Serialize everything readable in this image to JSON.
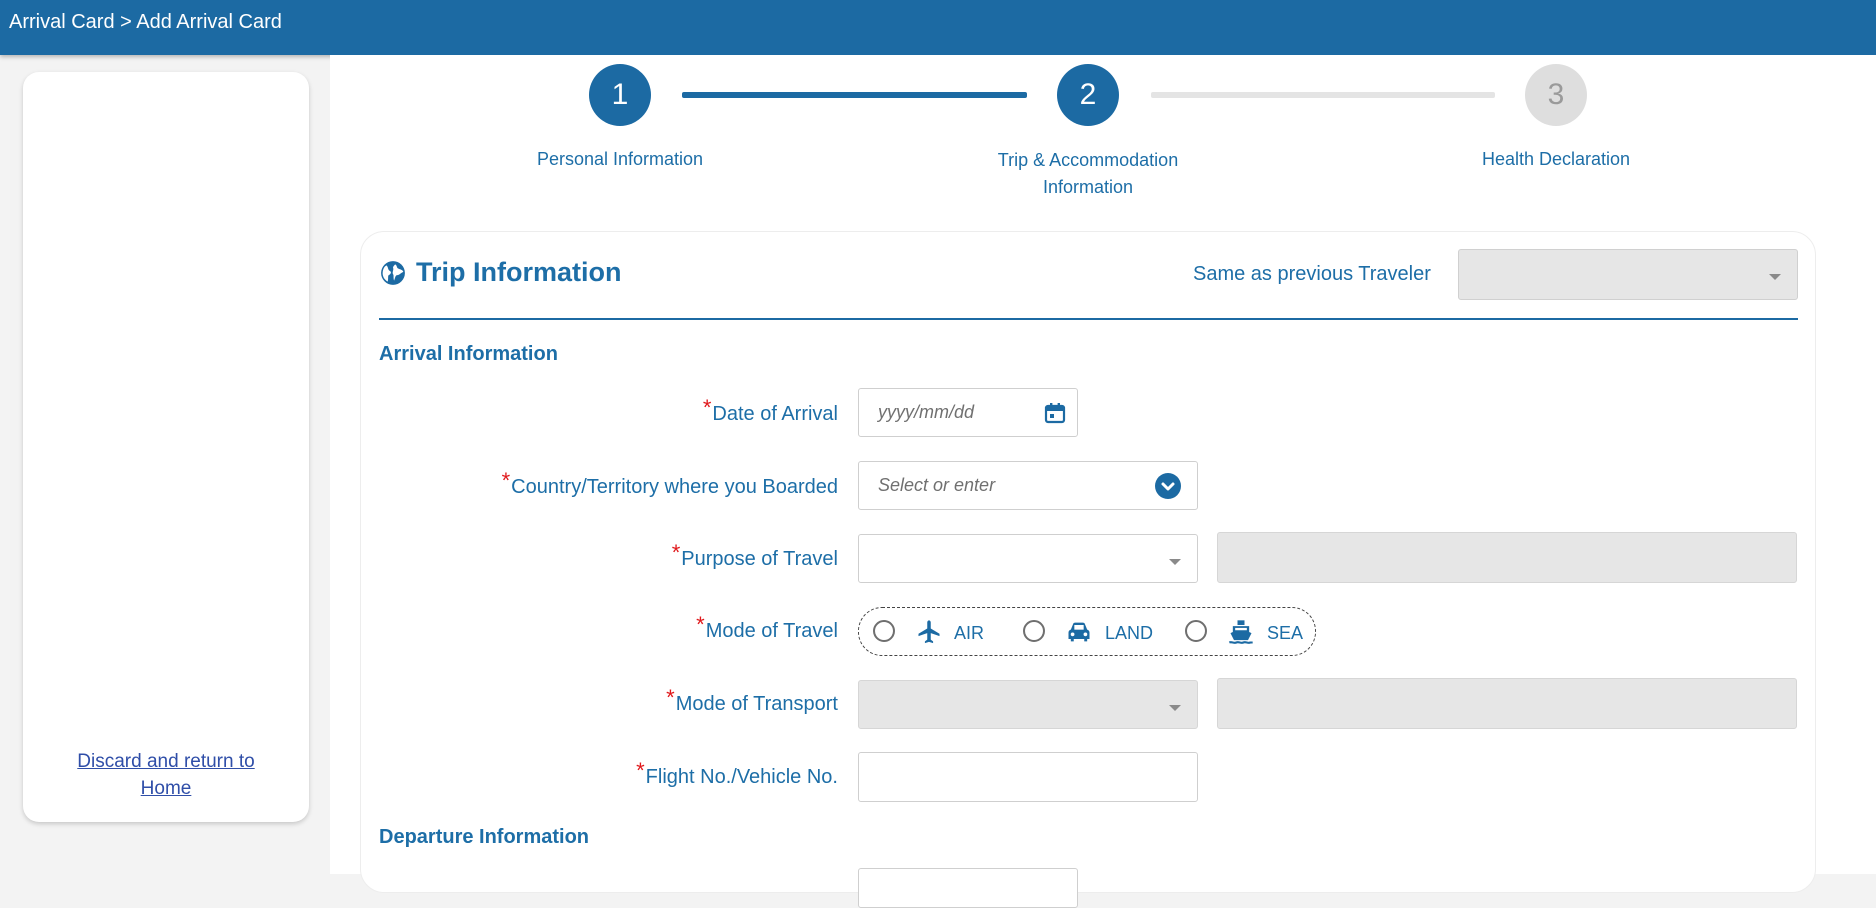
{
  "header": {
    "breadcrumb": "Arrival Card > Add Arrival Card"
  },
  "sidebar": {
    "discard_line1": "Discard and return to",
    "discard_line2": "Home"
  },
  "stepper": {
    "steps": [
      {
        "number": "1",
        "label_line1": "Personal Information",
        "label_line2": "",
        "state": "complete"
      },
      {
        "number": "2",
        "label_line1": "Trip & Accommodation",
        "label_line2": "Information",
        "state": "current"
      },
      {
        "number": "3",
        "label_line1": "Health Declaration",
        "label_line2": "",
        "state": "upcoming"
      }
    ]
  },
  "trip": {
    "title": "Trip Information",
    "same_as_previous_label": "Same as previous Traveler",
    "same_as_previous_value": ""
  },
  "arrival": {
    "section_title": "Arrival Information",
    "date_label": "Date of Arrival",
    "date_placeholder": "yyyy/mm/dd",
    "country_label": "Country/Territory where you Boarded",
    "country_placeholder": "Select or enter",
    "purpose_label": "Purpose of Travel",
    "purpose_value": "",
    "mode_travel_label": "Mode of Travel",
    "mode_options": [
      "AIR",
      "LAND",
      "SEA"
    ],
    "mode_transport_label": "Mode of Transport",
    "flight_label": "Flight No./Vehicle No.",
    "flight_value": ""
  },
  "departure": {
    "section_title": "Departure Information"
  },
  "required_marker": "*",
  "colors": {
    "brand": "#1c6aa3",
    "label": "#1d6ea7",
    "required": "#e0181b",
    "disabled_fill": "#e6e6e6",
    "link": "#2f4ea8"
  }
}
